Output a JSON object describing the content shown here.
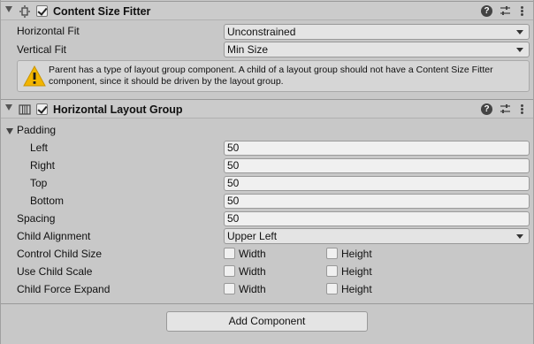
{
  "content_size_fitter": {
    "title": "Content Size Fitter",
    "horizontal_fit_label": "Horizontal Fit",
    "horizontal_fit_value": "Unconstrained",
    "vertical_fit_label": "Vertical Fit",
    "vertical_fit_value": "Min Size",
    "warning_line1": "Parent has a type of layout group component. A child of a layout group should not have a Content Size Fitter",
    "warning_line2": "component, since it should be driven by the layout group."
  },
  "horizontal_layout_group": {
    "title": "Horizontal Layout Group",
    "padding_label": "Padding",
    "left_label": "Left",
    "left_value": "50",
    "right_label": "Right",
    "right_value": "50",
    "top_label": "Top",
    "top_value": "50",
    "bottom_label": "Bottom",
    "bottom_value": "50",
    "spacing_label": "Spacing",
    "spacing_value": "50",
    "child_alignment_label": "Child Alignment",
    "child_alignment_value": "Upper Left",
    "control_child_size_label": "Control Child Size",
    "use_child_scale_label": "Use Child Scale",
    "child_force_expand_label": "Child Force Expand",
    "width_label": "Width",
    "height_label": "Height"
  },
  "help_glyph": "?",
  "add_component_label": "Add Component",
  "colors": {
    "warning": "#f2b500",
    "panel": "#c8c8c8"
  }
}
